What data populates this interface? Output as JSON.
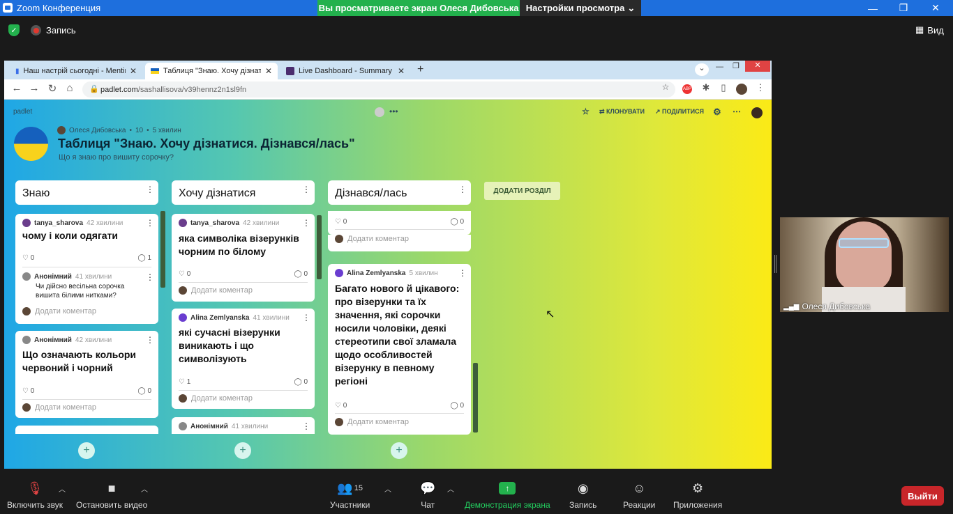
{
  "zoom": {
    "window_title": "Zoom Конференция",
    "share_banner": "Вы просматриваете экран Олеся Дибовська",
    "view_options": "Настройки просмотра",
    "record_label": "Запись",
    "view_label": "Вид",
    "participant_name": "Олеся Дибовська",
    "toolbar": {
      "mute": "Включить звук",
      "video": "Остановить видео",
      "participants": "Участники",
      "participants_count": "15",
      "chat": "Чат",
      "share": "Демонстрация экрана",
      "record": "Запись",
      "reactions": "Реакции",
      "apps": "Приложения",
      "leave": "Выйти"
    }
  },
  "browser": {
    "tabs": [
      {
        "title": "Наш настрій сьогодні - Mentime"
      },
      {
        "title": "Таблиця \"Знаю. Хочу дізнатися"
      },
      {
        "title": "Live Dashboard - Summary"
      }
    ],
    "url_host": "padlet.com",
    "url_path": "/sashallisova/v39hennz2n1sl9fn"
  },
  "padlet": {
    "logo": "padlet",
    "author": "Олеся Дибовська",
    "likes": "10",
    "time": "5 хвилин",
    "title": "Таблиця \"Знаю. Хочу дізнатися. Дізнався/лась\"",
    "subtitle": "Що я знаю про вишиту сорочку?",
    "clone": "КЛОНУВАТИ",
    "share": "ПОДІЛИТИСЯ",
    "add_section": "ДОДАТИ РОЗДІЛ",
    "add_comment": "Додати коментар",
    "columns": [
      {
        "title": "Знаю"
      },
      {
        "title": "Хочу дізнатися"
      },
      {
        "title": "Дізнався/лась"
      }
    ],
    "col1": {
      "c1": {
        "author": "tanya_sharova",
        "time": "42 хвилини",
        "body": "чому і коли одягати",
        "likes": "0",
        "comments": "1",
        "reply_author": "Анонімний",
        "reply_time": "41 хвилини",
        "reply_text": "Чи дійсно весільна сорочка вишита білими нитками?"
      },
      "c2": {
        "author": "Анонімний",
        "time": "42 хвилини",
        "body": "Що означають кольори червоний і чорний",
        "likes": "0",
        "comments": "0"
      }
    },
    "col2": {
      "c1": {
        "author": "tanya_sharova",
        "time": "42 хвилини",
        "body": "яка символіка візерунків чорним по білому",
        "likes": "0",
        "comments": "0"
      },
      "c2": {
        "author": "Alina Zemlyanska",
        "time": "41 хвилини",
        "body": "які сучасні візерунки виникають і що символізують",
        "likes": "1",
        "comments": "0"
      },
      "c3": {
        "author": "Анонімний",
        "time": "41 хвилини"
      }
    },
    "col3": {
      "c0": {
        "likes": "0",
        "comments": "0"
      },
      "c1": {
        "author": "Alina Zemlyanska",
        "time": "5 хвилин",
        "body": "Багато нового й цікавого: про візерунки та їх значення, які сорочки носили чоловіки, деякі стереотипи свої зламала щодо особливостей візерунку в певному регіоні",
        "likes": "0",
        "comments": "0"
      }
    }
  }
}
